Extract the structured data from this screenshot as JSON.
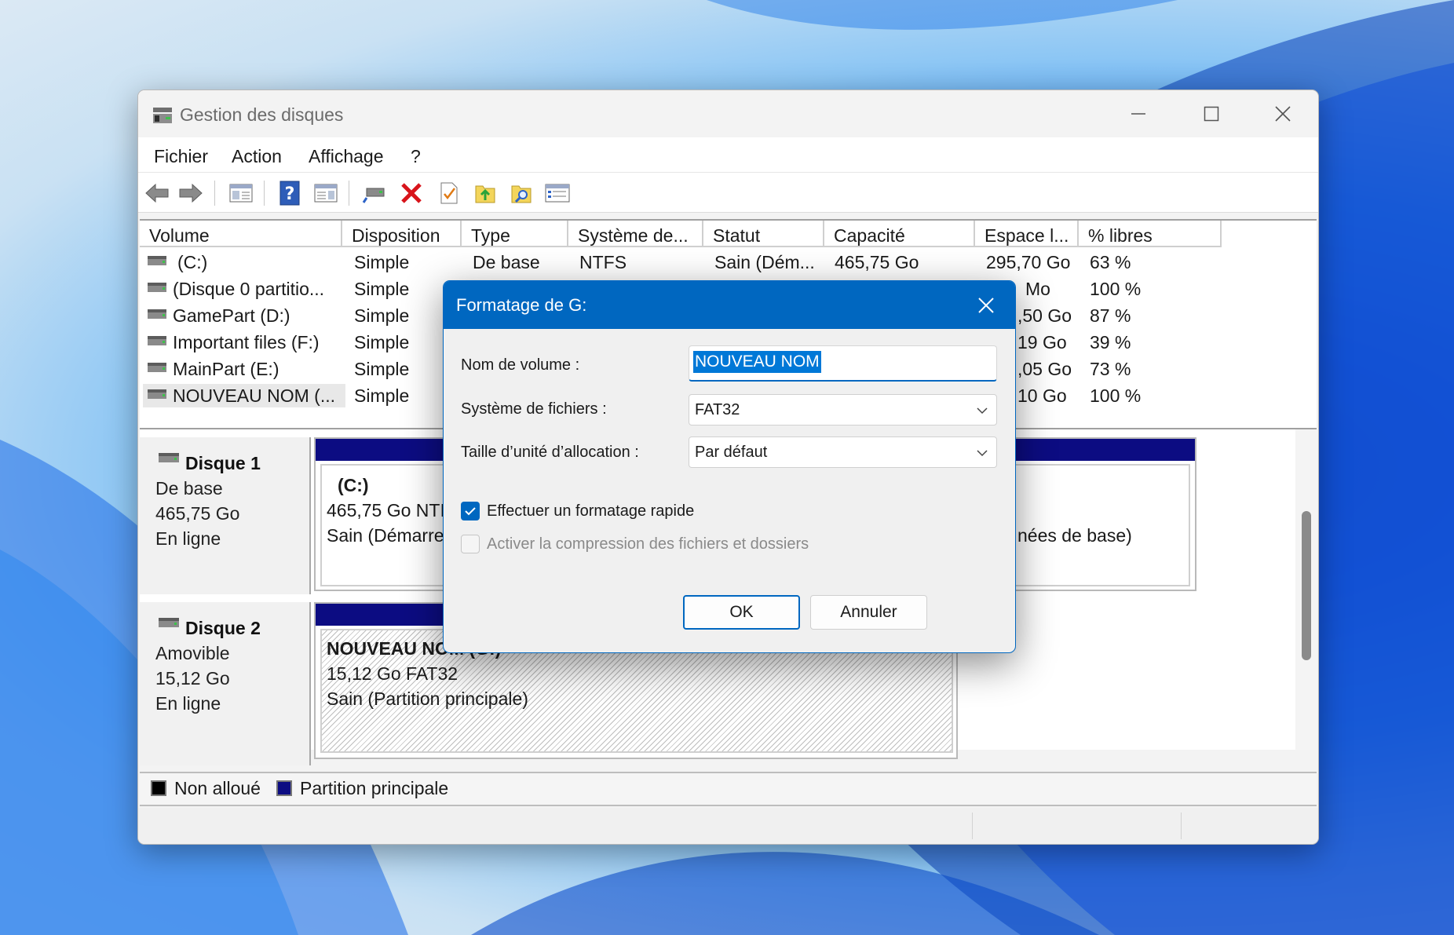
{
  "window": {
    "title": "Gestion des disques"
  },
  "menu": [
    "Fichier",
    "Action",
    "Affichage",
    "?"
  ],
  "toolbar": [
    "back-icon",
    "forward-icon",
    "view-panel-icon",
    "help-icon",
    "console-icon",
    "connect-drive-icon",
    "delete-icon",
    "check-icon",
    "folder-up-icon",
    "search-folder-icon",
    "properties-icon"
  ],
  "columns": [
    "Volume",
    "Disposition",
    "Type",
    "Système de...",
    "Statut",
    "Capacité",
    "Espace l...",
    "% libres"
  ],
  "volumes": [
    {
      "volume": "(C:)",
      "layout": "Simple",
      "type": "De base",
      "fs": "NTFS",
      "status": "Sain (Dém...",
      "capacity": "465,75 Go",
      "free": "295,70 Go",
      "pct": "63 %"
    },
    {
      "volume": "(Disque 0 partitio...",
      "layout": "Simple",
      "free": "Mo",
      "pct": "100 %"
    },
    {
      "volume": "GamePart (D:)",
      "layout": "Simple",
      "free": ",50 Go",
      "pct": "87 %"
    },
    {
      "volume": "Important files (F:)",
      "layout": "Simple",
      "free": "19 Go",
      "pct": "39 %"
    },
    {
      "volume": "MainPart (E:)",
      "layout": "Simple",
      "free": ",05 Go",
      "pct": "73 %"
    },
    {
      "volume": "NOUVEAU NOM (...",
      "layout": "Simple",
      "free": "10 Go",
      "pct": "100 %"
    }
  ],
  "disks": [
    {
      "name": "Disque 1",
      "type": "De base",
      "size": "465,75 Go",
      "state": "En ligne",
      "partition": {
        "title": "(C:)",
        "line1": "465,75 Go NTI",
        "line2": "Sain (Démarre"
      },
      "partition_right": "nées de base)"
    },
    {
      "name": "Disque 2",
      "type": "Amovible",
      "size": "15,12 Go",
      "state": "En ligne",
      "partition": {
        "title": "NOUVEAU NOM  (G:)",
        "line1": "15,12 Go FAT32",
        "line2": "Sain (Partition principale)"
      }
    }
  ],
  "legend": [
    {
      "label": "Non alloué",
      "color": "#000000"
    },
    {
      "label": "Partition principale",
      "color": "#0c0c82"
    }
  ],
  "dialog": {
    "title": "Formatage de G:",
    "volume_label": "Nom de volume :",
    "volume_value": "NOUVEAU NOM",
    "fs_label": "Système de fichiers :",
    "fs_value": "FAT32",
    "alloc_label": "Taille d’unité d’allocation :",
    "alloc_value": "Par défaut",
    "quick_format": {
      "label": "Effectuer un formatage rapide",
      "checked": true
    },
    "compression": {
      "label": "Activer la compression des fichiers et dossiers",
      "checked": false,
      "enabled": false
    },
    "ok": "OK",
    "cancel": "Annuler"
  },
  "colors": {
    "accent": "#0067c0",
    "partition": "#0c0c82"
  }
}
